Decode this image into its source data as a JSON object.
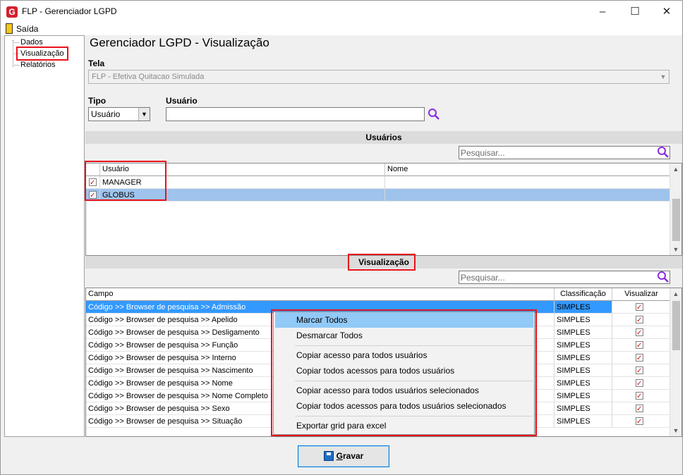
{
  "window": {
    "title": "FLP - Gerenciador LGPD",
    "app_icon_letter": "G",
    "minimize_glyph": "–",
    "maximize_glyph": "☐",
    "close_glyph": "✕"
  },
  "menu": {
    "exit_label": "Saída"
  },
  "sidebar": {
    "items": [
      {
        "label": "Dados"
      },
      {
        "label": "Visualização",
        "selected": true
      },
      {
        "label": "Relatórios"
      }
    ]
  },
  "main": {
    "heading": "Gerenciador LGPD - Visualização",
    "tela_label": "Tela",
    "tela_value": "FLP - Efetiva Quitacao Simulada",
    "tipo_label": "Tipo",
    "tipo_value": "Usuário",
    "usuario_label": "Usuário",
    "usuario_value": ""
  },
  "users_section": {
    "title": "Usuários",
    "search_placeholder": "Pesquisar...",
    "columns": [
      "Usuário",
      "Nome"
    ],
    "rows": [
      {
        "usuario": "MANAGER",
        "nome": "",
        "checked": true
      },
      {
        "usuario": "GLOBUS",
        "nome": "",
        "checked": true,
        "selected": true
      }
    ]
  },
  "view_section": {
    "title": "Visualização",
    "search_placeholder": "Pesquisar...",
    "columns": [
      "Campo",
      "Classificação",
      "Visualizar"
    ],
    "rows": [
      {
        "campo": "Código >> Browser de pesquisa >> Admissão",
        "classificacao": "SIMPLES",
        "visualizar": true,
        "highlighted": true
      },
      {
        "campo": "Código >> Browser de pesquisa >> Apelido",
        "classificacao": "SIMPLES",
        "visualizar": true
      },
      {
        "campo": "Código >> Browser de pesquisa >> Desligamento",
        "classificacao": "SIMPLES",
        "visualizar": true
      },
      {
        "campo": "Código >> Browser de pesquisa >> Função",
        "classificacao": "SIMPLES",
        "visualizar": true
      },
      {
        "campo": "Código >> Browser de pesquisa >> Interno",
        "classificacao": "SIMPLES",
        "visualizar": true
      },
      {
        "campo": "Código >> Browser de pesquisa >> Nascimento",
        "classificacao": "SIMPLES",
        "visualizar": true
      },
      {
        "campo": "Código >> Browser de pesquisa >> Nome",
        "classificacao": "SIMPLES",
        "visualizar": true
      },
      {
        "campo": "Código >> Browser de pesquisa >> Nome Completo",
        "classificacao": "SIMPLES",
        "visualizar": true
      },
      {
        "campo": "Código >> Browser de pesquisa >> Sexo",
        "classificacao": "SIMPLES",
        "visualizar": true
      },
      {
        "campo": "Código >> Browser de pesquisa >> Situação",
        "classificacao": "SIMPLES",
        "visualizar": true
      }
    ]
  },
  "context_menu": {
    "items": [
      {
        "label": "Marcar Todos",
        "active": true
      },
      {
        "label": "Desmarcar Todos"
      },
      {
        "label": "Copiar acesso para todos usuários"
      },
      {
        "label": "Copiar todos acessos para todos usuários"
      },
      {
        "label": "Copiar acesso para todos usuários selecionados"
      },
      {
        "label": "Copiar todos acessos para todos usuários selecionados"
      },
      {
        "label": "Exportar grid para excel"
      }
    ]
  },
  "footer": {
    "save_label": "Gravar",
    "save_mnemonic": "G"
  },
  "colors": {
    "highlight": "#e8111b",
    "selection": "#3399ff",
    "menu_active": "#91c9f7",
    "search_icon": "#8a2be2"
  }
}
